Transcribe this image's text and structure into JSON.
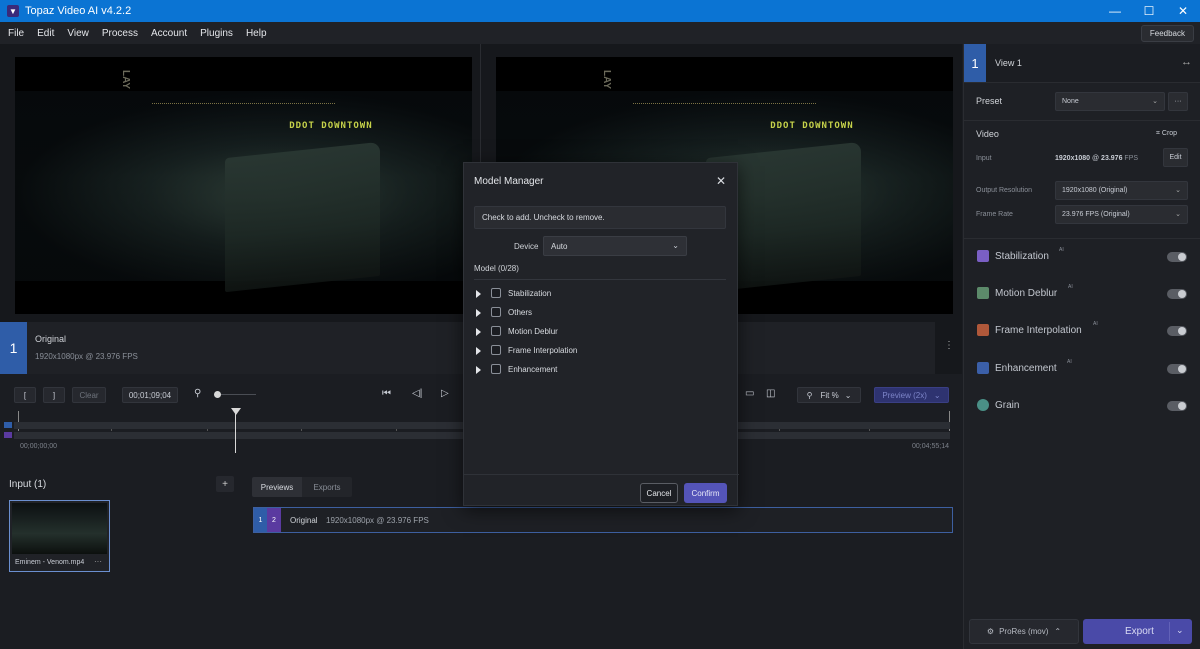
{
  "window": {
    "title": "Topaz Video AI  v4.2.2",
    "minimize": "—",
    "maximize": "☐",
    "close": "✕"
  },
  "menu": [
    "File",
    "Edit",
    "View",
    "Process",
    "Account",
    "Plugins",
    "Help"
  ],
  "feedback_label": "Feedback",
  "viewer": {
    "sign_text": "DDOT DOWNTOWN",
    "vertical_sign": "LAY",
    "original_num": "1",
    "original_label": "Original",
    "original_info": "1920x1080px @ 23.976 FPS",
    "more": "⋮"
  },
  "timeline": {
    "in_btn": "[",
    "out_btn": "]",
    "clear_btn": "Clear",
    "timecode": "00;01;09;04",
    "start_time": "00;00;00;00",
    "end_time": "00;04;55;14",
    "fit_label": "Fit %",
    "preview_btn": "Preview (2x)"
  },
  "input": {
    "title": "Input (1)",
    "add": "+",
    "file_name": "Eminem - Venom.mp4",
    "file_more": "···"
  },
  "previews": {
    "tab_previews": "Previews",
    "tab_exports": "Exports",
    "row_n1": "1",
    "row_n2": "2",
    "row_label": "Original",
    "row_info": "1920x1080px @ 23.976 FPS"
  },
  "right": {
    "view_num": "1",
    "view_label": "View 1",
    "expand": "↔",
    "preset_label": "Preset",
    "preset_value": "None",
    "preset_more": "···",
    "video_label": "Video",
    "crop_label": "Crop",
    "input_label": "Input",
    "input_value_res": "1920x1080",
    "input_value_at": " @ ",
    "input_value_fps": "23.976",
    "input_value_unit": " FPS",
    "edit_label": "Edit",
    "output_res_label": "Output Resolution",
    "output_res_value": "1920x1080 (Original)",
    "frame_rate_label": "Frame Rate",
    "frame_rate_value": "23.976 FPS (Original)",
    "features": [
      {
        "name": "Stabilization",
        "ai": "AI",
        "color": "#7a5fc4"
      },
      {
        "name": "Motion Deblur",
        "ai": "AI",
        "color": "#5c8a6a"
      },
      {
        "name": "Frame Interpolation",
        "ai": "AI",
        "color": "#b0583a"
      },
      {
        "name": "Enhancement",
        "ai": "AI",
        "color": "#3b5fa8"
      },
      {
        "name": "Grain",
        "ai": "",
        "color": "#4a8f86"
      }
    ],
    "format_btn": "ProRes (mov)",
    "export_btn": "Export"
  },
  "modal": {
    "title": "Model Manager",
    "close": "✕",
    "hint": "Check to add. Uncheck to remove.",
    "device_label": "Device",
    "device_value": "Auto",
    "model_count": "Model (0/28)",
    "models": [
      "Stabilization",
      "Others",
      "Motion Deblur",
      "Frame Interpolation",
      "Enhancement"
    ],
    "cancel": "Cancel",
    "confirm": "Confirm"
  }
}
